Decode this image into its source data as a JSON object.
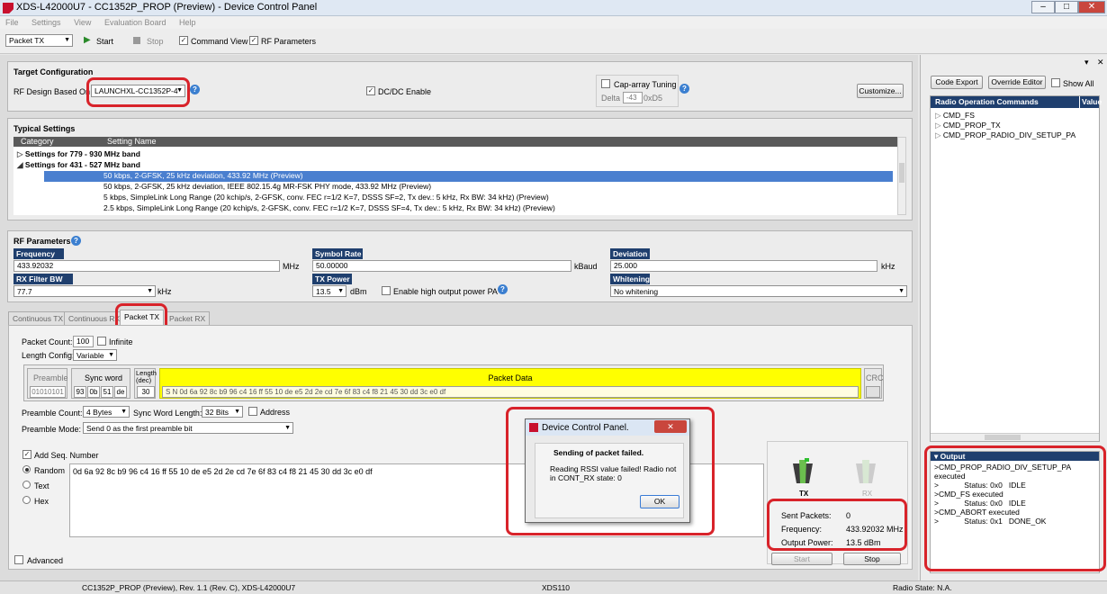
{
  "window": {
    "title": "XDS-L42000U7 - CC1352P_PROP (Preview) - Device Control Panel"
  },
  "menu": [
    "File",
    "Settings",
    "View",
    "Evaluation Board",
    "Help"
  ],
  "toolbar": {
    "mode": "Packet TX",
    "start_label": "Start",
    "stop_label": "Stop",
    "command_view_label": "Command View",
    "rf_parameters_label": "RF Parameters"
  },
  "target": {
    "header": "Target Configuration",
    "rf_design_label": "RF Design Based On",
    "rf_design_value": "LAUNCHXL-CC1352P-4",
    "dcdc_label": "DC/DC Enable",
    "cap_array_label": "Cap-array Tuning",
    "delta_label": "Delta",
    "delta_value": "-43",
    "hex_value": "0xD5",
    "customize_label": "Customize..."
  },
  "typical": {
    "header": "Typical Settings",
    "col_category": "Category",
    "col_setting": "Setting Name",
    "groups": [
      "Settings for 779 - 930 MHz band",
      "Settings for 431 - 527 MHz band"
    ],
    "rows": [
      "50 kbps, 2-GFSK, 25 kHz deviation, 433.92 MHz (Preview)",
      "50 kbps, 2-GFSK, 25 kHz deviation, IEEE 802.15.4g MR-FSK PHY mode, 433.92 MHz (Preview)",
      "5 kbps, SimpleLink Long Range (20 kchip/s, 2-GFSK, conv. FEC r=1/2 K=7, DSSS SF=2, Tx dev.: 5 kHz, Rx BW: 34 kHz) (Preview)",
      "2.5 kbps, SimpleLink Long Range (20 kchip/s, 2-GFSK, conv. FEC r=1/2 K=7, DSSS SF=4, Tx dev.: 5 kHz, Rx BW: 34 kHz) (Preview)"
    ]
  },
  "rf": {
    "header": "RF Parameters",
    "frequency_label": "Frequency",
    "frequency_value": "433.92032",
    "frequency_unit": "MHz",
    "symbol_rate_label": "Symbol Rate",
    "symbol_rate_value": "50.00000",
    "symbol_rate_unit": "kBaud",
    "deviation_label": "Deviation",
    "deviation_value": "25.000",
    "deviation_unit": "kHz",
    "rx_bw_label": "RX Filter BW",
    "rx_bw_value": "77.7",
    "rx_bw_unit": "kHz",
    "tx_power_label": "TX Power",
    "tx_power_value": "13.5",
    "tx_power_unit": "dBm",
    "high_pa_label": "Enable high output power PA",
    "whitening_label": "Whitening",
    "whitening_value": "No whitening"
  },
  "tabs": [
    "Continuous TX",
    "Continuous RX",
    "Packet TX",
    "Packet RX"
  ],
  "packet": {
    "count_label": "Packet Count:",
    "count_value": "100",
    "infinite_label": "Infinite",
    "length_config_label": "Length Config:",
    "length_config_value": "Variable",
    "preamble_label": "Preamble",
    "preamble_value": "01010101",
    "sync_word_label": "Sync word",
    "sync_bytes": [
      "93",
      "0b",
      "51",
      "de"
    ],
    "length_label": "Length (dec)",
    "length_value": "30",
    "packet_data_label": "Packet Data",
    "packet_data_value": "S N 0d 6a 92 8c b9 96 c4 16 ff 55 10 de e5 2d 2e cd 7e 6f 83 c4 f8 21 45 30 dd 3c e0 df",
    "crc_label": "CRC",
    "preamble_count_label": "Preamble Count:",
    "preamble_count_value": "4 Bytes",
    "sync_len_label": "Sync Word Length:",
    "sync_len_value": "32 Bits",
    "address_label": "Address",
    "preamble_mode_label": "Preamble Mode:",
    "preamble_mode_value": "Send 0 as the first preamble bit",
    "add_seq_label": "Add Seq. Number",
    "radio_random": "Random",
    "radio_text": "Text",
    "radio_hex": "Hex",
    "payload": "0d 6a 92 8c b9 96 c4 16 ff 55 10 de e5 2d 2e cd 7e 6f 83 c4 f8 21 45 30 dd 3c e0 df",
    "advanced_label": "Advanced"
  },
  "status_panel": {
    "tx_label": "TX",
    "rx_label": "RX",
    "sent_label": "Sent Packets:",
    "sent_value": "0",
    "freq_label": "Frequency:",
    "freq_value": "433.92032 MHz",
    "power_label": "Output Power:",
    "power_value": "13.5 dBm",
    "start_label": "Start",
    "stop_label": "Stop"
  },
  "dialog": {
    "title": "Device Control Panel.",
    "heading": "Sending of packet failed.",
    "message": "Reading RSSI value failed! Radio not in CONT_RX state: 0",
    "ok_label": "OK"
  },
  "right": {
    "code_export": "Code Export",
    "override_editor": "Override Editor",
    "show_all": "Show All",
    "col_commands": "Radio Operation Commands",
    "col_value": "Value",
    "commands": [
      "CMD_FS",
      "CMD_PROP_TX",
      "CMD_PROP_RADIO_DIV_SETUP_PA"
    ],
    "output_header": "Output",
    "output_lines": [
      ">CMD_PROP_RADIO_DIV_SETUP_PA",
      "executed",
      ">            Status: 0x0   IDLE",
      ">CMD_FS executed",
      ">            Status: 0x0   IDLE",
      ">CMD_ABORT executed",
      ">            Status: 0x1   DONE_OK"
    ]
  },
  "statusbar": {
    "left": "CC1352P_PROP (Preview), Rev. 1.1 (Rev. C), XDS-L42000U7",
    "mid": "XDS110",
    "right": "Radio State: N.A."
  },
  "colors": {
    "accent_red": "#d8232a",
    "header_blue": "#1f3f6e",
    "packet_yellow": "#ffff00",
    "selection": "#4a7fcf"
  }
}
